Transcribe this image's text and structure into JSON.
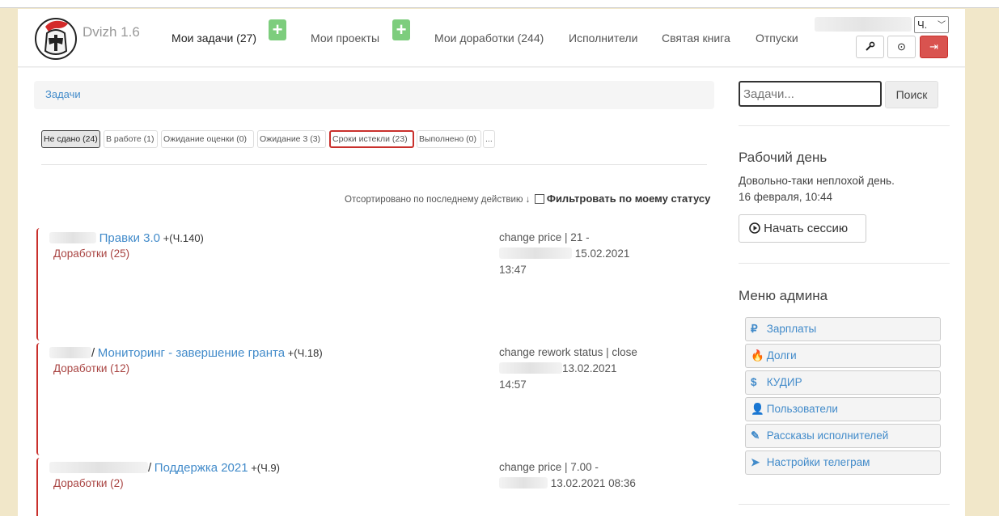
{
  "app": {
    "name": "Dvizh 1.6"
  },
  "nav": {
    "my_tasks": "Мои задачи (27)",
    "my_projects": "Мои проекты",
    "my_reworks": "Мои доработки (244)",
    "executors": "Исполнители",
    "holy_book": "Святая книга",
    "vacations": "Отпуски",
    "plus": "+",
    "lang": "Ч."
  },
  "toolbar": {
    "wrench": "🔧",
    "clock": "⊙",
    "logout": "⇥"
  },
  "breadcrumb": "Задачи",
  "filters": [
    {
      "label": "Не сдано (24)"
    },
    {
      "label": "В работе (1)"
    },
    {
      "label": "Ожидание оценки (0)"
    },
    {
      "label": "Ожидание 3 (3)"
    },
    {
      "label": "Сроки истекли (23)"
    },
    {
      "label": "Выполнено (0)"
    },
    {
      "label": "..."
    }
  ],
  "sort": {
    "text": "Отсортировано по последнему действию ↓",
    "filter_label": "Фильтровать по моему статусу"
  },
  "tasks": [
    {
      "project": "Правки 3.0",
      "estimate": "+(Ч.140)",
      "sub": "Доработки (25)",
      "info1": "change price | 21 -",
      "info2": "15.02.2021",
      "info3": "13:47"
    },
    {
      "project": "Мониторинг - завершение гранта",
      "estimate": "+(Ч.18)",
      "sub": "Доработки (12)",
      "info1": "change rework status | close",
      "info2": "13.02.2021",
      "info3": "14:57"
    },
    {
      "project": "Поддержка 2021",
      "estimate": "+(Ч.9)",
      "sub": "Доработки (2)",
      "info1": "change price | 7.00 -",
      "info2": "13.02.2021 08:36",
      "info3": ""
    }
  ],
  "search": {
    "placeholder": "Задачи...",
    "button": "Поиск"
  },
  "workday": {
    "title": "Рабочий день",
    "text1": "Довольно-таки неплохой день.",
    "text2": "16 февраля, 10:44",
    "session_button": "Начать сессию"
  },
  "admin_menu": {
    "title": "Меню админа",
    "items": [
      {
        "icon": "₽",
        "label": "Зарплаты"
      },
      {
        "icon": "🔥",
        "label": "Долги"
      },
      {
        "icon": "$",
        "label": "КУДИР"
      },
      {
        "icon": "👤",
        "label": "Пользователи"
      },
      {
        "icon": "✎",
        "label": "Рассказы исполнителей"
      },
      {
        "icon": "➤",
        "label": "Настройки телеграм"
      }
    ]
  }
}
